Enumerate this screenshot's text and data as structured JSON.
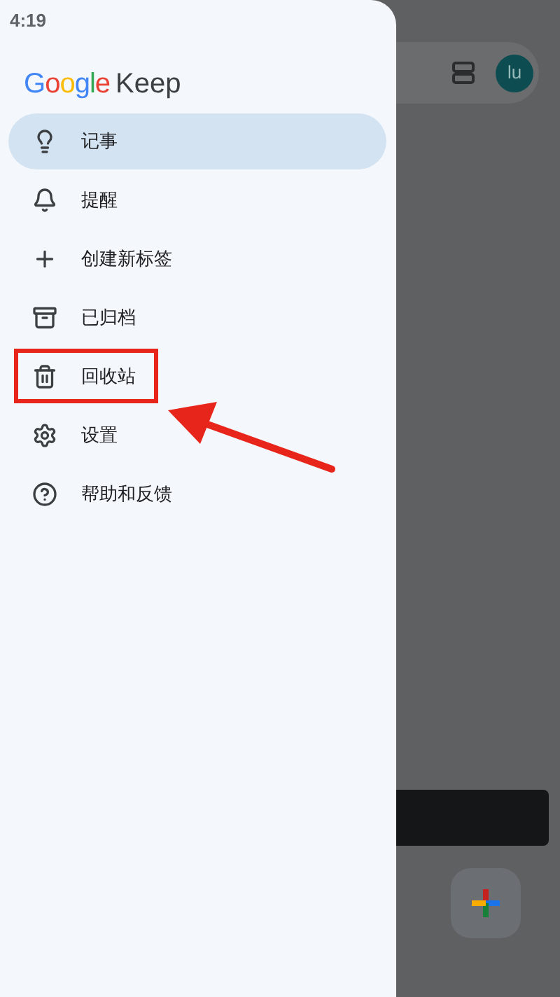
{
  "status_bar": {
    "time": "4:19"
  },
  "drawer": {
    "logo": {
      "brand": "Google",
      "product": "Keep"
    },
    "items": [
      {
        "kind": "notes",
        "label": "记事",
        "selected": true,
        "annotated": false
      },
      {
        "kind": "reminders",
        "label": "提醒",
        "selected": false,
        "annotated": false
      },
      {
        "kind": "new-label",
        "label": "创建新标签",
        "selected": false,
        "annotated": false
      },
      {
        "kind": "archive",
        "label": "已归档",
        "selected": false,
        "annotated": false
      },
      {
        "kind": "trash",
        "label": "回收站",
        "selected": false,
        "annotated": true
      },
      {
        "kind": "settings",
        "label": "设置",
        "selected": false,
        "annotated": false
      },
      {
        "kind": "help",
        "label": "帮助和反馈",
        "selected": false,
        "annotated": false
      }
    ]
  },
  "background": {
    "avatar": "lu"
  }
}
